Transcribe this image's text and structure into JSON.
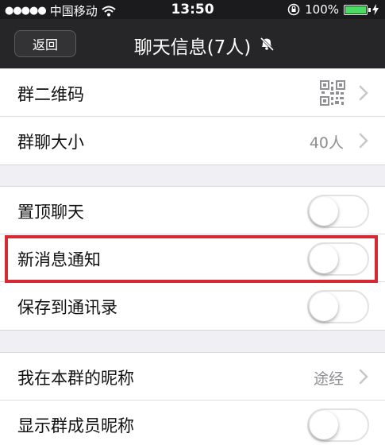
{
  "status_bar": {
    "carrier": "中国移动",
    "time": "13:50",
    "battery": "100%"
  },
  "nav": {
    "back_label": "返回",
    "title": "聊天信息(7人)"
  },
  "groups": [
    {
      "rows": [
        {
          "label": "群二维码",
          "control": "qr-chevron"
        },
        {
          "label": "群聊大小",
          "value": "40人",
          "control": "chevron"
        }
      ]
    },
    {
      "rows": [
        {
          "label": "置顶聊天",
          "control": "toggle",
          "on": false
        },
        {
          "label": "新消息通知",
          "control": "toggle",
          "on": false
        },
        {
          "label": "保存到通讯录",
          "control": "toggle",
          "on": false
        }
      ]
    },
    {
      "rows": [
        {
          "label": "我在本群的昵称",
          "value": "途经",
          "control": "chevron"
        },
        {
          "label": "显示群成员昵称",
          "control": "toggle",
          "on": false
        }
      ]
    }
  ],
  "colors": {
    "nav_bg": "#262628",
    "highlight": "#d42a32",
    "battery": "#4cd964"
  },
  "icons": [
    "signal-dots-icon",
    "wifi-icon",
    "rotation-lock-icon",
    "battery-icon",
    "charging-icon",
    "mute-bell-icon",
    "qr-code-icon",
    "chevron-right-icon"
  ]
}
